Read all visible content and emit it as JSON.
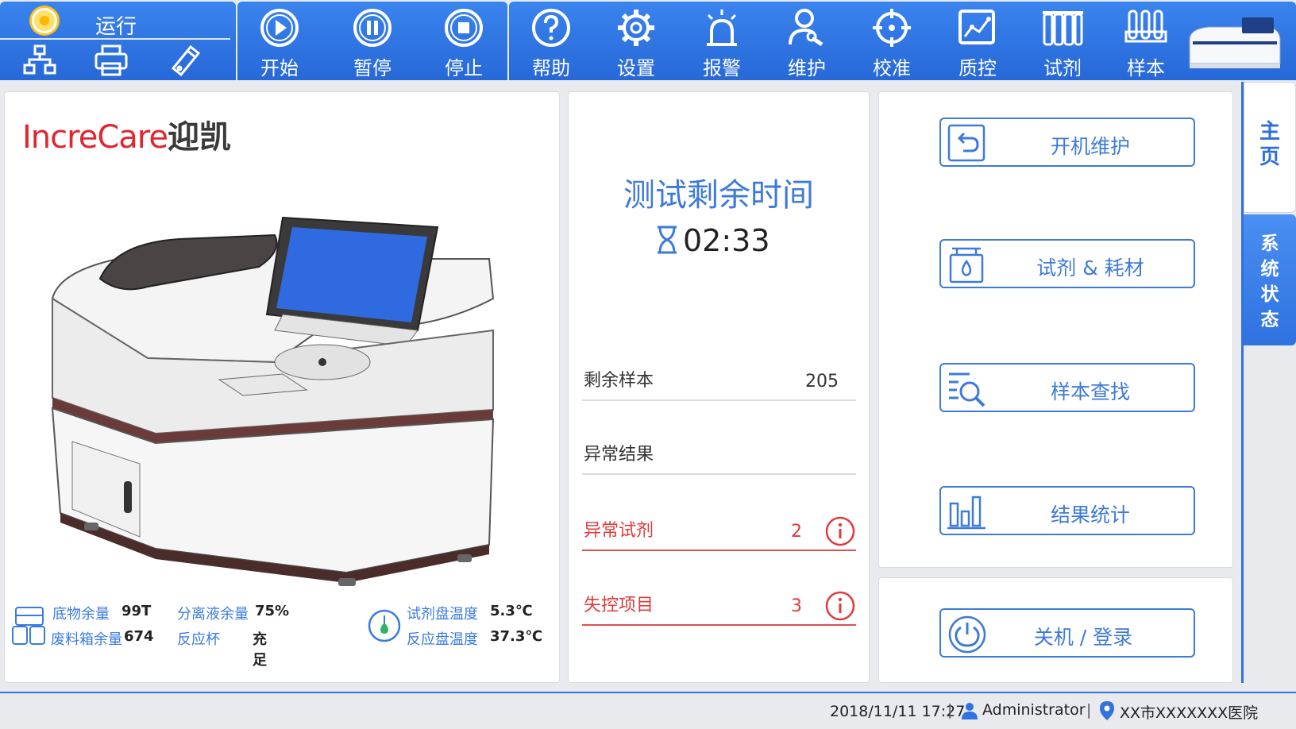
{
  "toolbar": {
    "run_status": "运行",
    "status_icons": [
      "network-icon",
      "printer-icon",
      "usb-drive-icon"
    ],
    "controls": [
      {
        "label": "开始",
        "icon": "play-icon"
      },
      {
        "label": "暂停",
        "icon": "pause-icon"
      },
      {
        "label": "停止",
        "icon": "stop-icon"
      }
    ],
    "menu": [
      {
        "label": "帮助",
        "icon": "help-icon"
      },
      {
        "label": "设置",
        "icon": "gear-icon"
      },
      {
        "label": "报警",
        "icon": "alarm-icon"
      },
      {
        "label": "维护",
        "icon": "maintenance-icon"
      },
      {
        "label": "校准",
        "icon": "calibration-icon"
      },
      {
        "label": "质控",
        "icon": "quality-control-icon"
      },
      {
        "label": "试剂",
        "icon": "reagent-icon"
      },
      {
        "label": "样本",
        "icon": "sample-icon"
      }
    ]
  },
  "brand": {
    "latin": "IncreCare",
    "chinese": "迎凯"
  },
  "machine_info": {
    "substrate_label": "底物余量",
    "substrate_value": "99T",
    "waste_label": "废料箱余量",
    "waste_value": "674",
    "separation_label": "分离液余量",
    "separation_value": "75%",
    "cuvette_label": "反应杯",
    "cuvette_value": "充足",
    "reagent_temp_label": "试剂盘温度",
    "reagent_temp_value": "5.3℃",
    "reaction_temp_label": "反应盘温度",
    "reaction_temp_value": "37.3℃"
  },
  "test": {
    "remaining_time_title": "测试剩余时间",
    "remaining_time": "02:33",
    "remaining_samples_label": "剩余样本",
    "remaining_samples_value": "205",
    "abnormal_results_label": "异常结果",
    "abnormal_reagents_label": "异常试剂",
    "abnormal_reagents_value": "2",
    "out_of_control_label": "失控项目",
    "out_of_control_value": "3"
  },
  "actions": [
    {
      "label": "开机维护",
      "icon": "startup-maintenance-icon"
    },
    {
      "label": "试剂 & 耗材",
      "icon": "reagent-consumables-icon"
    },
    {
      "label": "样本查找",
      "icon": "sample-search-icon"
    },
    {
      "label": "结果统计",
      "icon": "result-statistics-icon"
    }
  ],
  "power": {
    "label": "关机 / 登录",
    "icon": "power-icon"
  },
  "side_tabs": {
    "home": "主页",
    "system_status": "系统状态"
  },
  "statusbar": {
    "datetime": "2018/11/11 17:27",
    "user": "Administrator",
    "location": "XX市XXXXXXX医院"
  },
  "colors": {
    "primary": "#2f72e0",
    "alert": "#e03a3a",
    "brand_red": "#e0262e"
  }
}
